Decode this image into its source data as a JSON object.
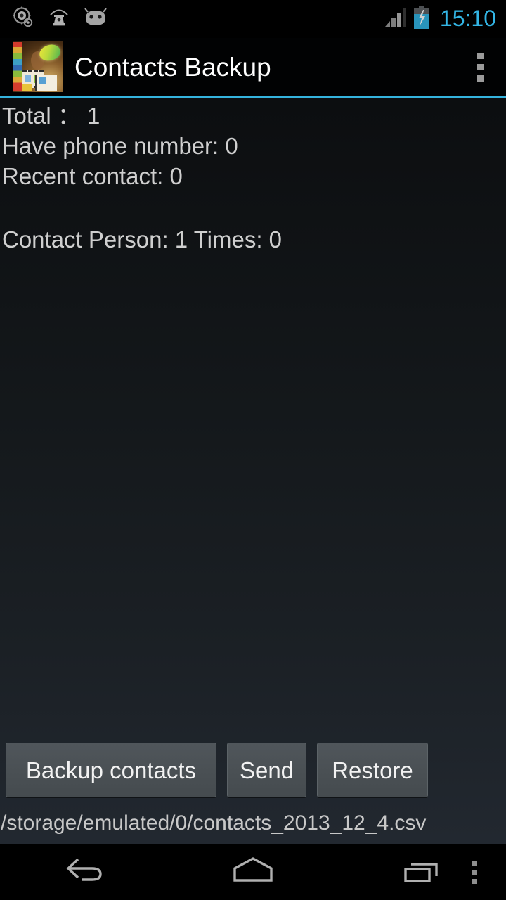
{
  "status_bar": {
    "icons": [
      "camera-gear-icon",
      "telephone-icon",
      "android-head-icon"
    ],
    "signal_icon": "signal-bars-icon",
    "battery_icon": "battery-charging-icon",
    "time": "15:10",
    "time_color": "#33b5e5"
  },
  "action_bar": {
    "app_icon": "contacts-backup-app-icon",
    "title": "Contacts Backup",
    "overflow_icon": "overflow-menu-icon",
    "accent_color": "#34b3dd"
  },
  "main": {
    "stats": [
      "Total ： 1",
      "Have phone number: 0",
      "Recent contact: 0"
    ],
    "summary": "Contact Person: 1 Times: 0",
    "buttons": {
      "backup": "Backup contacts",
      "send": "Send",
      "restore": "Restore"
    },
    "file_path": "/storage/emulated/0/contacts_2013_12_4.csv"
  },
  "nav_bar": {
    "back": "back-icon",
    "home": "home-icon",
    "recents": "recent-apps-icon",
    "menu": "menu-icon"
  }
}
